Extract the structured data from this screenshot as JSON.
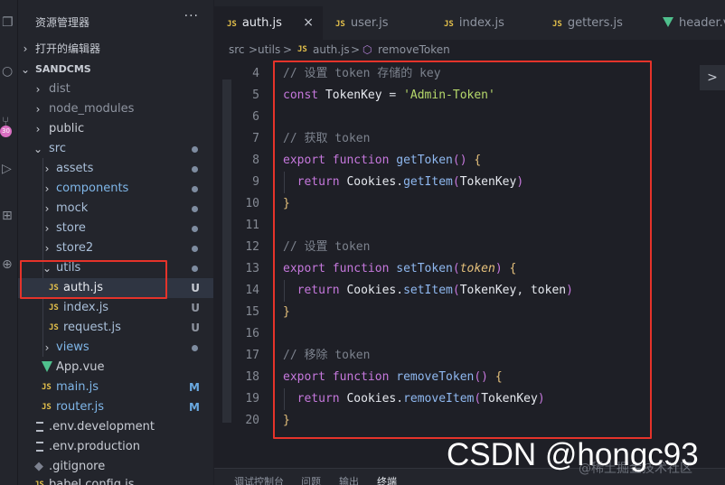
{
  "sidebar": {
    "title": "资源管理器",
    "more": "···",
    "sections": {
      "open_editors": "打开的编辑器",
      "project": "SANDCMS"
    },
    "items": [
      {
        "label": "dist",
        "type": "folder",
        "expanded": false
      },
      {
        "label": "node_modules",
        "type": "folder",
        "expanded": false
      },
      {
        "label": "public",
        "type": "folder",
        "expanded": false
      },
      {
        "label": "src",
        "type": "folder",
        "expanded": true
      },
      {
        "label": "assets",
        "type": "folder",
        "expanded": false
      },
      {
        "label": "components",
        "type": "folder",
        "expanded": false
      },
      {
        "label": "mock",
        "type": "folder",
        "expanded": false
      },
      {
        "label": "store",
        "type": "folder",
        "expanded": false
      },
      {
        "label": "store2",
        "type": "folder",
        "expanded": false
      },
      {
        "label": "utils",
        "type": "folder",
        "expanded": true
      },
      {
        "label": "auth.js",
        "type": "js",
        "status": "U"
      },
      {
        "label": "index.js",
        "type": "js",
        "status": "U"
      },
      {
        "label": "request.js",
        "type": "js",
        "status": "U"
      },
      {
        "label": "views",
        "type": "folder",
        "expanded": false
      },
      {
        "label": "App.vue",
        "type": "vue"
      },
      {
        "label": "main.js",
        "type": "js",
        "status": "M"
      },
      {
        "label": "router.js",
        "type": "js",
        "status": "M"
      },
      {
        "label": ".env.development",
        "type": "env"
      },
      {
        "label": ".env.production",
        "type": "env"
      },
      {
        "label": ".gitignore",
        "type": "git"
      },
      {
        "label": "babel.config.js",
        "type": "js"
      }
    ],
    "activity_badge": "30"
  },
  "tabs": [
    {
      "label": "auth.js",
      "icon": "js-icon",
      "active": true
    },
    {
      "label": "user.js",
      "icon": "js-icon"
    },
    {
      "label": "index.js",
      "icon": "js-icon"
    },
    {
      "label": "getters.js",
      "icon": "js-icon"
    },
    {
      "label": "header.vu",
      "icon": "vue-icon"
    }
  ],
  "breadcrumb": {
    "a": "src",
    "b": "utils",
    "c": "auth.js",
    "d": "removeToken",
    "js": "JS",
    "sep": ">"
  },
  "icons": {
    "js_badge": "JS",
    "close": "×",
    "collapse": ">"
  },
  "editor": {
    "lines": [
      {
        "n": "4",
        "text": "// 设置 token 存储的 key"
      },
      {
        "n": "5",
        "text": "const TokenKey = 'Admin-Token'"
      },
      {
        "n": "6",
        "text": ""
      },
      {
        "n": "7",
        "text": "// 获取 token"
      },
      {
        "n": "8",
        "text": "export function getToken() {"
      },
      {
        "n": "9",
        "text": "  return Cookies.getItem(TokenKey)"
      },
      {
        "n": "10",
        "text": "}"
      },
      {
        "n": "11",
        "text": ""
      },
      {
        "n": "12",
        "text": "// 设置 token"
      },
      {
        "n": "13",
        "text": "export function setToken(token) {"
      },
      {
        "n": "14",
        "text": "  return Cookies.setItem(TokenKey, token)"
      },
      {
        "n": "15",
        "text": "}"
      },
      {
        "n": "16",
        "text": ""
      },
      {
        "n": "17",
        "text": "// 移除 token"
      },
      {
        "n": "18",
        "text": "export function removeToken() {"
      },
      {
        "n": "19",
        "text": "  return Cookies.removeItem(TokenKey)"
      },
      {
        "n": "20",
        "text": "}"
      }
    ]
  },
  "panel_tabs": [
    "调试控制台",
    "问题",
    "输出",
    "终端"
  ],
  "watermark": {
    "main": "CSDN @hongc93",
    "sub": "@稀土掘金技术社区"
  }
}
